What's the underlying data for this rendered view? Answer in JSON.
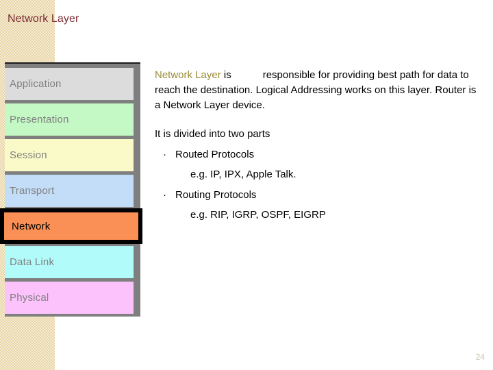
{
  "slide": {
    "title": "Network Layer",
    "page_number": "24",
    "title_color": "#7c2b33",
    "accent_color": "#998c33",
    "page_number_color": "#c9c3a7",
    "strip_color": "#f6ecd2"
  },
  "layer_stack": {
    "name": "osi-layer-stack",
    "layers": [
      {
        "label": "Application",
        "color": "#dcdcdc",
        "highlighted": false
      },
      {
        "label": "Presentation",
        "color": "#c4f8c4",
        "highlighted": false
      },
      {
        "label": "Session",
        "color": "#fafac8",
        "highlighted": false
      },
      {
        "label": "Transport",
        "color": "#c3ddf8",
        "highlighted": false
      },
      {
        "label": "Network",
        "color": "#fa9055",
        "highlighted": true
      },
      {
        "label": "Data Link",
        "color": "#b2fbfb",
        "highlighted": false
      },
      {
        "label": "Physical",
        "color": "#fbc2fb",
        "highlighted": false
      }
    ]
  },
  "content": {
    "intro": {
      "accent": "Network Layer",
      "lead": " is",
      "rest": "responsible for providing best path for data to reach the  destination. Logical Addressing works on this layer. Router is a Network Layer device."
    },
    "divided_line": "It is divided into two parts",
    "bullets": [
      {
        "marker": "·",
        "label": "Routed Protocols",
        "example": "e.g. IP, IPX, Apple Talk."
      },
      {
        "marker": "·",
        "label": "Routing Protocols",
        "example": "e.g. RIP, IGRP, OSPF, EIGRP"
      }
    ]
  }
}
